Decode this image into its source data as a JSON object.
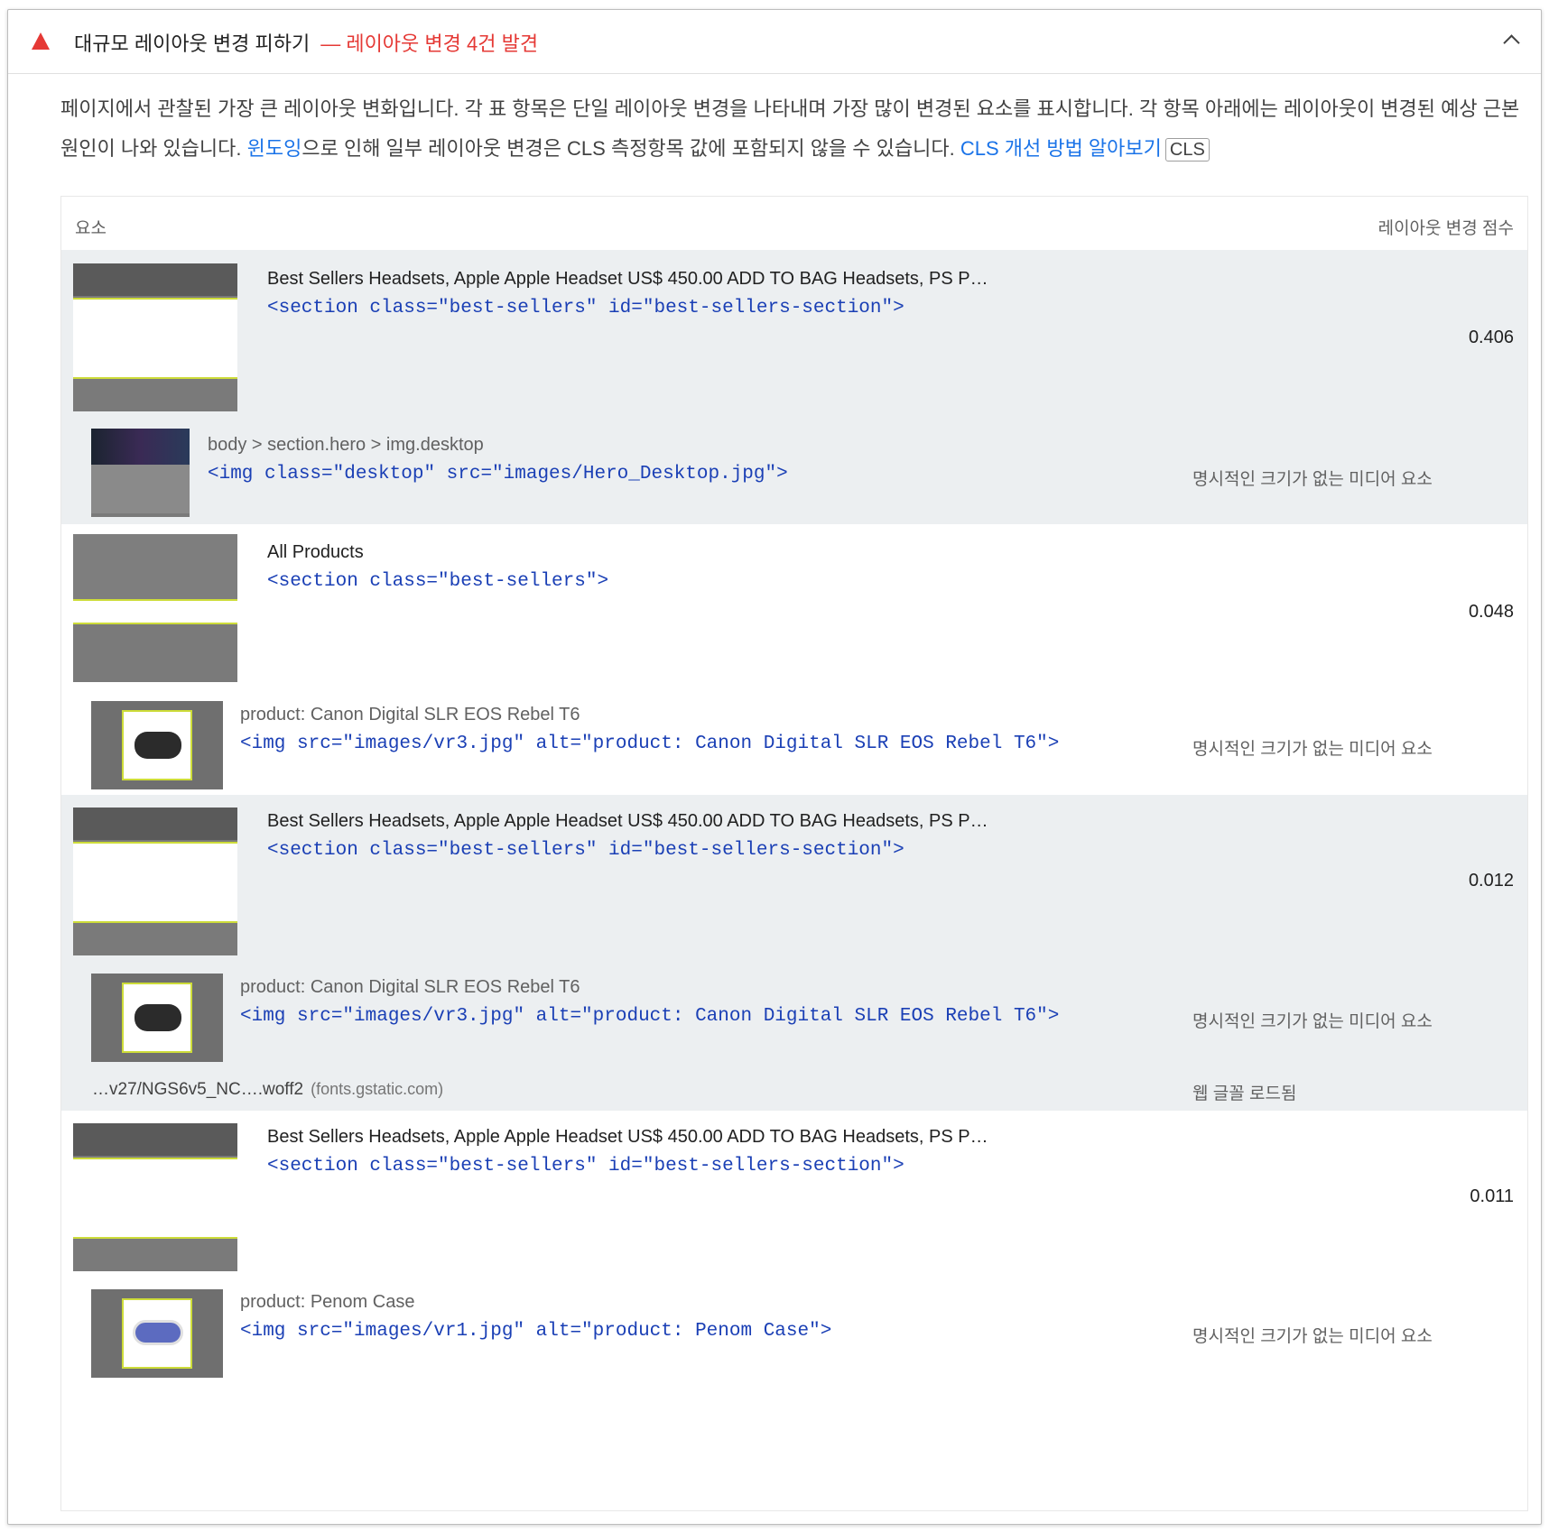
{
  "header": {
    "title": "대규모 레이아웃 변경 피하기",
    "suffix": "— 레이아웃 변경 4건 발견"
  },
  "description": {
    "text1": "페이지에서 관찰된 가장 큰 레이아웃 변화입니다. 각 표 항목은 단일 레이아웃 변경을 나타내며 가장 많이 변경된 요소를 표시합니다. 각 항목 아래에는 레이아웃이 변경된 예상 근본 원인이 나와 있습니다. ",
    "link1": "윈도잉",
    "text2": "으로 인해 일부 레이아웃 변경은 CLS 측정항목 값에 포함되지 않을 수 있습니다. ",
    "link2": "CLS 개선 방법 알아보기",
    "badge": "CLS"
  },
  "table": {
    "col_element": "요소",
    "col_score": "레이아웃 변경 점수",
    "rows": [
      {
        "label": "Best Sellers Headsets, Apple Apple Headset US$ 450.00 ADD TO BAG Headsets, PS P…",
        "code": "<section class=\"best-sellers\" id=\"best-sellers-section\">",
        "score": "0.406",
        "cause": {
          "label": "body > section.hero > img.desktop",
          "code": "<img class=\"desktop\" src=\"images/Hero_Desktop.jpg\">",
          "reason": "명시적인 크기가 없는 미디어 요소"
        }
      },
      {
        "label": "All Products",
        "code": "<section class=\"best-sellers\">",
        "score": "0.048",
        "cause": {
          "label": "product: Canon Digital SLR EOS Rebel T6",
          "code": "<img src=\"images/vr3.jpg\" alt=\"product: Canon Digital SLR EOS Rebel T6\">",
          "reason": "명시적인 크기가 없는 미디어 요소"
        }
      },
      {
        "label": "Best Sellers Headsets, Apple Apple Headset US$ 450.00 ADD TO BAG Headsets, PS P…",
        "code": "<section class=\"best-sellers\" id=\"best-sellers-section\">",
        "score": "0.012",
        "cause": {
          "label": "product: Canon Digital SLR EOS Rebel T6",
          "code": "<img src=\"images/vr3.jpg\" alt=\"product: Canon Digital SLR EOS Rebel T6\">",
          "reason": "명시적인 크기가 없는 미디어 요소"
        },
        "font": {
          "url": "…v27/NGS6v5_NC….woff2",
          "host": "(fonts.gstatic.com)",
          "reason": "웹 글꼴 로드됨"
        }
      },
      {
        "label": "Best Sellers Headsets, Apple Apple Headset US$ 450.00 ADD TO BAG Headsets, PS P…",
        "code": "<section class=\"best-sellers\" id=\"best-sellers-section\">",
        "score": "0.011",
        "cause": {
          "label": "product: Penom Case",
          "code": "<img src=\"images/vr1.jpg\" alt=\"product: Penom Case\">",
          "reason": "명시적인 크기가 없는 미디어 요소"
        }
      }
    ]
  },
  "colors": {
    "warning": "#e53935",
    "link": "#1a73e8",
    "code": "#1a3fb5",
    "row_shade": "#eceff1",
    "thumb_accent": "#cddc39"
  }
}
